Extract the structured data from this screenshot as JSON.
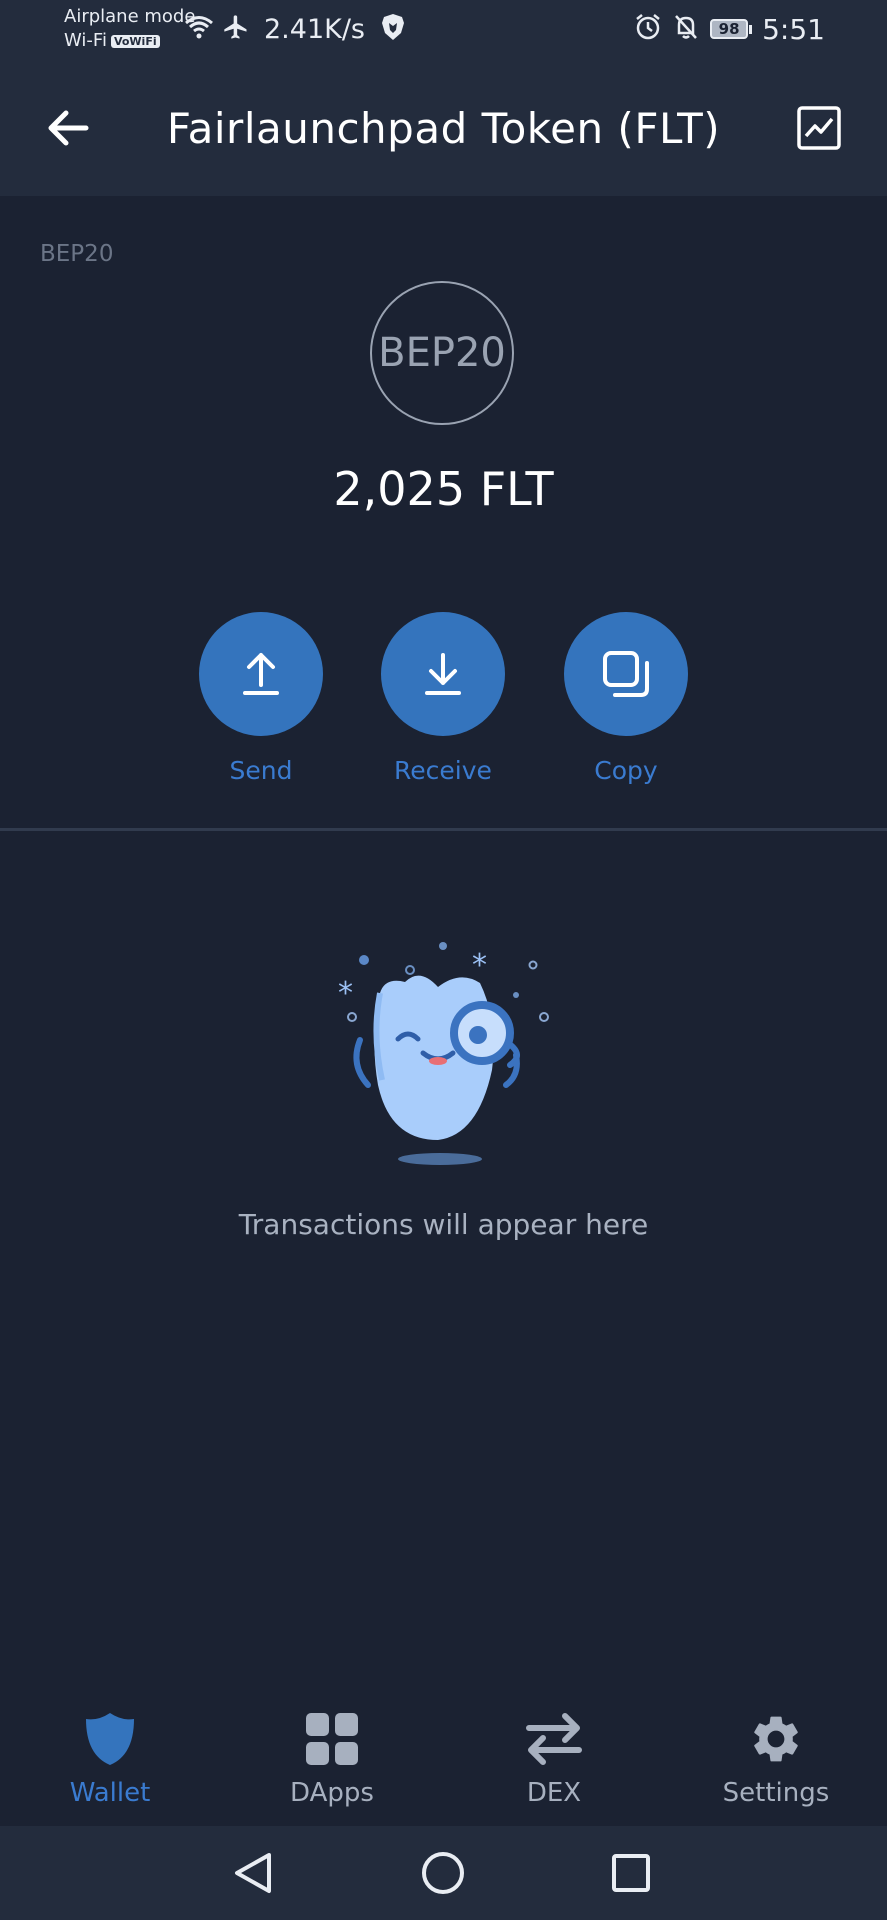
{
  "status_bar": {
    "line1": "Airplane mode",
    "line2": "Wi-Fi",
    "wifi_badge": "VoWiFi",
    "speed": "2.41K/s",
    "battery": "98",
    "time": "5:51"
  },
  "header": {
    "title": "Fairlaunchpad Token (FLT)"
  },
  "token": {
    "network": "BEP20",
    "logo_text": "BEP20",
    "balance": "2,025 FLT"
  },
  "actions": {
    "send": "Send",
    "receive": "Receive",
    "copy": "Copy"
  },
  "transactions": {
    "empty_message": "Transactions will appear here"
  },
  "bottom_nav": {
    "wallet": "Wallet",
    "dapps": "DApps",
    "dex": "DEX",
    "settings": "Settings",
    "active": "Wallet"
  },
  "colors": {
    "accent": "#3474bd",
    "background": "#1b2232",
    "header": "#232c3d"
  }
}
